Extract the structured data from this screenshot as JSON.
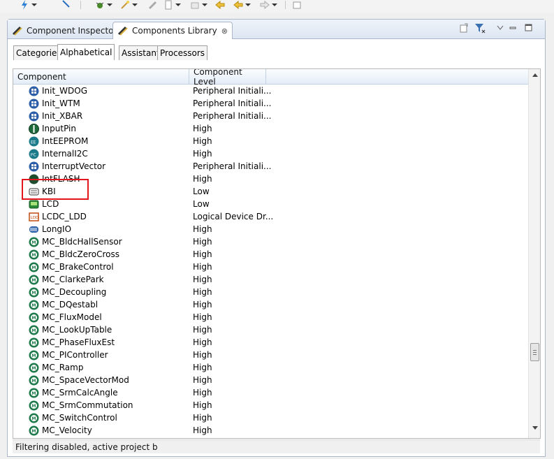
{
  "toolbar": {
    "icons": [
      "lightning-icon",
      "pin-icon",
      "bug-icon",
      "wand-icon",
      "pencil-icon",
      "document-icon",
      "up-folder-icon",
      "back-icon",
      "forward-back-icon",
      "forward-icon",
      "export-icon"
    ]
  },
  "view_tabs": [
    {
      "label": "Component Inspector",
      "icon": "inspector-icon"
    },
    {
      "label": "Components Library",
      "icon": "library-icon",
      "close": "⊗"
    }
  ],
  "subtabs": [
    "Categories",
    "Alphabetical",
    "Assistant",
    "Processors"
  ],
  "table": {
    "columns": [
      "Component",
      "Component Level"
    ],
    "rows": [
      {
        "name": "Init_WDOG",
        "level": "Peripheral Initiali...",
        "icon": "init"
      },
      {
        "name": "Init_WTM",
        "level": "Peripheral Initiali...",
        "icon": "init"
      },
      {
        "name": "Init_XBAR",
        "level": "Peripheral Initiali...",
        "icon": "init"
      },
      {
        "name": "InputPin",
        "level": "High",
        "icon": "pin"
      },
      {
        "name": "IntEEPROM",
        "level": "High",
        "icon": "eeprom"
      },
      {
        "name": "InternalI2C",
        "level": "High",
        "icon": "i2c"
      },
      {
        "name": "InterruptVector",
        "level": "Peripheral Initiali...",
        "icon": "init"
      },
      {
        "name": "IntFLASH",
        "level": "High",
        "icon": "flash"
      },
      {
        "name": "KBI",
        "level": "Low",
        "icon": "kbi"
      },
      {
        "name": "LCD",
        "level": "Low",
        "icon": "lcd"
      },
      {
        "name": "LCDC_LDD",
        "level": "Logical Device Dr...",
        "icon": "ldd"
      },
      {
        "name": "LongIO",
        "level": "High",
        "icon": "longio"
      },
      {
        "name": "MC_BldcHallSensor",
        "level": "High",
        "icon": "mc"
      },
      {
        "name": "MC_BldcZeroCross",
        "level": "High",
        "icon": "mc"
      },
      {
        "name": "MC_BrakeControl",
        "level": "High",
        "icon": "mc"
      },
      {
        "name": "MC_ClarkePark",
        "level": "High",
        "icon": "mc"
      },
      {
        "name": "MC_Decoupling",
        "level": "High",
        "icon": "mc"
      },
      {
        "name": "MC_DQestabl",
        "level": "High",
        "icon": "mc"
      },
      {
        "name": "MC_FluxModel",
        "level": "High",
        "icon": "mc"
      },
      {
        "name": "MC_LookUpTable",
        "level": "High",
        "icon": "mc"
      },
      {
        "name": "MC_PhaseFluxEst",
        "level": "High",
        "icon": "mc"
      },
      {
        "name": "MC_PIController",
        "level": "High",
        "icon": "mc"
      },
      {
        "name": "MC_Ramp",
        "level": "High",
        "icon": "mc"
      },
      {
        "name": "MC_SpaceVectorMod",
        "level": "High",
        "icon": "mc"
      },
      {
        "name": "MC_SrmCalcAngle",
        "level": "High",
        "icon": "mc"
      },
      {
        "name": "MC_SrmCommutation",
        "level": "High",
        "icon": "mc"
      },
      {
        "name": "MC_SwitchControl",
        "level": "High",
        "icon": "mc"
      },
      {
        "name": "MC_Velocity",
        "level": "High",
        "icon": "mc"
      }
    ]
  },
  "status": "Filtering disabled, active project b",
  "colors": {
    "highlight": "#e2161c",
    "tab_border": "#a9b7c9"
  }
}
